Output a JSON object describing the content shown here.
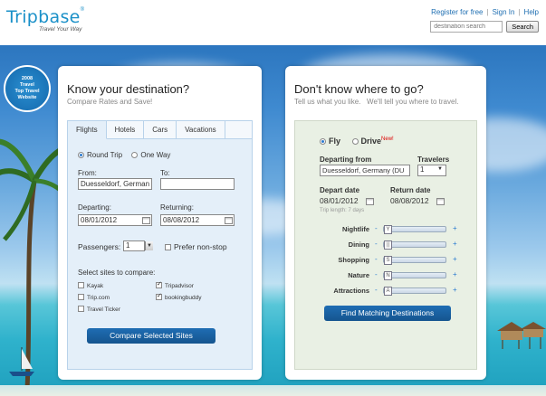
{
  "header": {
    "logo": "Tripbase",
    "logo_reg": "®",
    "tagline": "Travel Your Way",
    "links": [
      "Register for free",
      "Sign In",
      "Help"
    ],
    "search_placeholder": "destination search",
    "search_button": "Search"
  },
  "badge": {
    "lines": [
      "2008",
      "Travel",
      "Top Travel",
      "Website"
    ]
  },
  "left": {
    "title": "Know your destination?",
    "subtitle": "Compare Rates and Save!",
    "tabs": [
      "Flights",
      "Hotels",
      "Cars",
      "Vacations"
    ],
    "trip_types": [
      "Round Trip",
      "One Way"
    ],
    "from_label": "From:",
    "to_label": "To:",
    "from_value": "Duesseldorf, German",
    "to_value": "",
    "departing_label": "Departing:",
    "returning_label": "Returning:",
    "departing_value": "08/01/2012",
    "returning_value": "08/08/2012",
    "passengers_label": "Passengers:",
    "passengers_value": "1",
    "nonstop_label": "Prefer non-stop",
    "compare_label": "Select sites to compare:",
    "sites": [
      {
        "name": "Kayak",
        "checked": false
      },
      {
        "name": "Tripadvisor",
        "checked": true
      },
      {
        "name": "Trip.com",
        "checked": false
      },
      {
        "name": "bookingbuddy",
        "checked": true
      },
      {
        "name": "Travel Ticker",
        "checked": false
      }
    ],
    "compare_button": "Compare Selected Sites"
  },
  "right": {
    "title": "Don't know where to go?",
    "subtitle": "Tell us what you like.   We'll tell you where to travel.",
    "modes": [
      "Fly",
      "Drive"
    ],
    "new_tag": "New!",
    "departing_from_label": "Departing from",
    "departing_from_value": "Duesseldorf, Germany (DU",
    "travelers_label": "Travelers",
    "travelers_value": "1",
    "depart_date_label": "Depart date",
    "return_date_label": "Return date",
    "depart_date_value": "08/01/2012",
    "return_date_value": "08/08/2012",
    "trip_length": "Trip length: 7 days",
    "preferences": [
      {
        "name": "Nightlife",
        "icon": "Y"
      },
      {
        "name": "Dining",
        "icon": "||"
      },
      {
        "name": "Shopping",
        "icon": "S"
      },
      {
        "name": "Nature",
        "icon": "N"
      },
      {
        "name": "Attractions",
        "icon": "A"
      }
    ],
    "minus": "-",
    "plus": "+",
    "find_button": "Find Matching Destinations"
  }
}
